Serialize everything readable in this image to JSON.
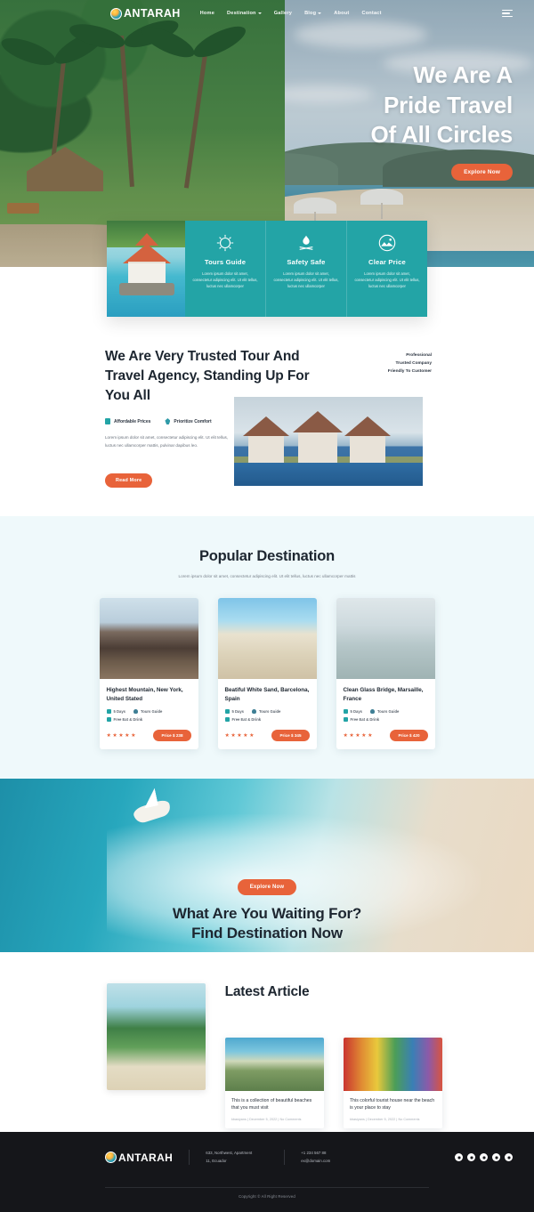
{
  "brand": {
    "name": "ANTARAH",
    "accent": "#e8633a",
    "teal": "#23a4a6"
  },
  "nav": {
    "items": [
      {
        "label": "Home",
        "has_dropdown": false
      },
      {
        "label": "Destination",
        "has_dropdown": true
      },
      {
        "label": "Gallery",
        "has_dropdown": false
      },
      {
        "label": "Blog",
        "has_dropdown": true
      },
      {
        "label": "About",
        "has_dropdown": false
      },
      {
        "label": "Contact",
        "has_dropdown": false
      }
    ],
    "menu_icon": "hamburger-icon"
  },
  "hero": {
    "title_line1": "We Are A",
    "title_line2": "Pride Travel",
    "title_line3": "Of All Circles",
    "cta_label": "Explore Now"
  },
  "features": [
    {
      "icon": "compass-icon",
      "title": "Tours Guide",
      "desc": "Lorem ipsum dolor sit amet, consectetur adipiscing elit. Ut elit tellus, luctus nec ullamcorper"
    },
    {
      "icon": "campfire-icon",
      "title": "Safety Safe",
      "desc": "Lorem ipsum dolor sit amet, consectetur adipiscing elit. Ut elit tellus, luctus nec ullamcorper"
    },
    {
      "icon": "mountain-sun-icon",
      "title": "Clear Price",
      "desc": "Lorem ipsum dolor sit amet, consectetur adipiscing elit. Ut elit tellus, luctus nec ullamcorper"
    }
  ],
  "trusted": {
    "heading": "We Are Very Trusted Tour And Travel Agency, Standing Up For You All",
    "tags": [
      "Professional",
      "Trusted Company",
      "Friendly To Customer"
    ],
    "chips": [
      {
        "icon": "price-tag-icon",
        "label": "Affordable Prices"
      },
      {
        "icon": "comfort-icon",
        "label": "Prioritize Comfort"
      }
    ],
    "paragraph": "Lorem ipsum dolor sit amet, consectetur adipiscing elit. Ut elit tellus, luctus nec ullamcorper mattis, pulvinar dapibus leo.",
    "cta_label": "Read More"
  },
  "popular": {
    "title": "Popular Destination",
    "subtitle": "Lorem ipsum dolor sit amet, consectetur adipiscing elit. Ut elit tellus, luctus nec ullamcorper mattis",
    "cards": [
      {
        "title": "Highest Mountain, New York, United Stated",
        "days": "5 Days",
        "guide": "Tours Guide",
        "extra": "Free Eat & Drink",
        "rating": 5,
        "price_label": "Price $ 238"
      },
      {
        "title": "Beatiful White Sand, Barcelona, Spain",
        "days": "5 Days",
        "guide": "Tours Guide",
        "extra": "Free Eat & Drink",
        "rating": 5,
        "price_label": "Price $ 345"
      },
      {
        "title": "Clean Glass Bridge, Marsaille, France",
        "days": "5 Days",
        "guide": "Tours Guide",
        "extra": "Free Eat & Drink",
        "rating": 5,
        "price_label": "Price $ 420"
      }
    ]
  },
  "cta_banner": {
    "button_label": "Explore Now",
    "line1": "What Are You Waiting For?",
    "line2": "Find Destination Now"
  },
  "latest": {
    "title": "Latest Article",
    "articles": [
      {
        "title": "This is a collection of beautiful beaches that you must visit",
        "meta": "kbasiyans | December 5, 2022 | No Comments"
      },
      {
        "title": "This colorful tourist house near the beach is your place to stay",
        "meta": "kbasiyans | December 5, 2022 | No Comments"
      }
    ]
  },
  "footer": {
    "brand": "ANTARAH",
    "address_line1": "633, Northwest, Apartment",
    "address_line2": "11, Ecuador",
    "phone": "+1 234 567 88",
    "email": "ex@domain.com",
    "socials": [
      "facebook-icon",
      "twitter-icon",
      "instagram-icon",
      "linkedin-icon",
      "youtube-icon"
    ],
    "copyright": "Copyright © All Right Reserved"
  }
}
